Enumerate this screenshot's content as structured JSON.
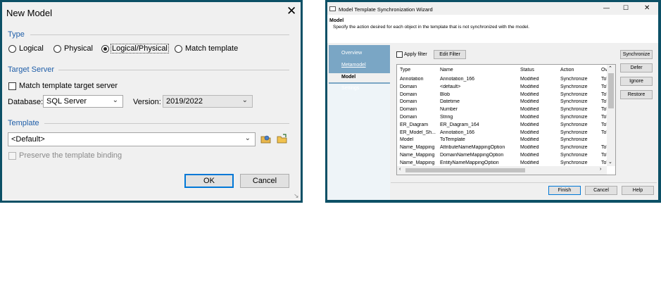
{
  "new_model": {
    "title": "New Model",
    "close": "✕",
    "type_section": "Type",
    "radios": [
      {
        "label": "Logical",
        "selected": false
      },
      {
        "label": "Physical",
        "selected": false
      },
      {
        "label": "Logical/Physical",
        "selected": true
      },
      {
        "label": "Match template",
        "selected": false
      }
    ],
    "target_server_section": "Target Server",
    "match_template_target": "Match template target server",
    "database_label": "Database:",
    "database_value": "SQL Server",
    "version_label": "Version:",
    "version_value": "2019/2022",
    "template_section": "Template",
    "template_value": "<Default>",
    "preserve_binding": "Preserve the template binding",
    "ok_label": "OK",
    "cancel_label": "Cancel"
  },
  "wizard": {
    "title": "Model Template Synchronization Wizard",
    "close": "✕",
    "maximize": "☐",
    "minimize": "—",
    "header_title": "Model",
    "header_desc": "Specify the action desired for each object in the template that is not synchronized with the model.",
    "nav": [
      "Overview",
      "Metamodel",
      "Model",
      "Settings"
    ],
    "apply_filter": "Apply filter",
    "edit_filter": "Edit Filter",
    "columns": [
      "Type",
      "Name",
      "Status",
      "Action",
      "Ov"
    ],
    "rows": [
      [
        "Annotation",
        "Annotation_166",
        "Modified",
        "Synchronize",
        "To'"
      ],
      [
        "Domain",
        "<default>",
        "Modified",
        "Synchronize",
        "To'"
      ],
      [
        "Domain",
        "Blob",
        "Modified",
        "Synchronize",
        "To'"
      ],
      [
        "Domain",
        "Datetime",
        "Modified",
        "Synchronize",
        "To'"
      ],
      [
        "Domain",
        "Number",
        "Modified",
        "Synchronize",
        "To'"
      ],
      [
        "Domain",
        "String",
        "Modified",
        "Synchronize",
        "To'"
      ],
      [
        "ER_Diagram",
        "ER_Diagram_164",
        "Modified",
        "Synchronize",
        "To'"
      ],
      [
        "ER_Model_Sh...",
        "Annotation_166",
        "Modified",
        "Synchronize",
        "To'"
      ],
      [
        "Model",
        "ToTemplate",
        "Modified",
        "Synchronize",
        ""
      ],
      [
        "Name_Mapping",
        "AttributeNameMappingOption",
        "Modified",
        "Synchronize",
        "To'"
      ],
      [
        "Name_Mapping",
        "DomainNameMappingOption",
        "Modified",
        "Synchronize",
        "To'"
      ],
      [
        "Name_Mapping",
        "EntityNameMappingOption",
        "Modified",
        "Synchronize",
        "To'"
      ]
    ],
    "side_buttons": [
      "Synchronize",
      "Defer",
      "Ignore",
      "Restore"
    ],
    "bottom_buttons": [
      "Finish",
      "Cancel",
      "Help"
    ]
  }
}
